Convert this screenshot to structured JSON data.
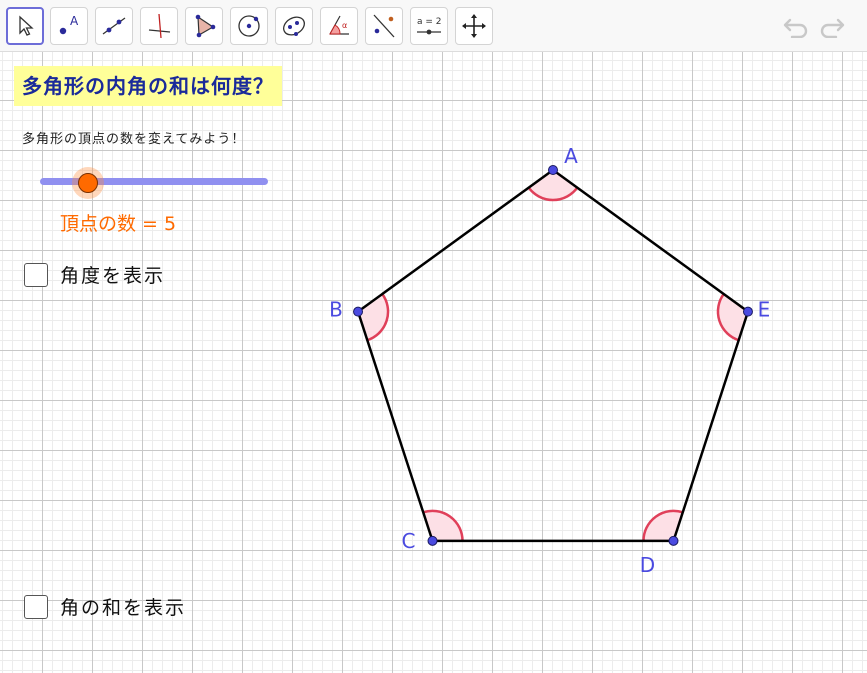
{
  "toolbar": {
    "tools": [
      {
        "name": "move-tool-icon",
        "active": true
      },
      {
        "name": "point-tool-icon",
        "glyph": "A"
      },
      {
        "name": "line-tool-icon"
      },
      {
        "name": "perpendicular-line-tool-icon"
      },
      {
        "name": "polygon-tool-icon"
      },
      {
        "name": "circle-tool-icon"
      },
      {
        "name": "conic-tool-icon"
      },
      {
        "name": "angle-tool-icon"
      },
      {
        "name": "reflect-tool-icon"
      },
      {
        "name": "slider-tool-icon",
        "glyph": "a = 2"
      },
      {
        "name": "move-graphics-view-tool-icon"
      }
    ],
    "undo_icon": "undo-icon",
    "redo_icon": "redo-icon"
  },
  "panel": {
    "title": "多角形の内角の和は何度？",
    "instruction": "多角形の頂点の数を変えてみよう！",
    "slider": {
      "label": "頂点の数",
      "value": 5,
      "min": 3,
      "max": 12
    },
    "slider_readout": "頂点の数 = 5",
    "checkbox_show_angles": {
      "label": "角度を表示",
      "checked": false
    },
    "checkbox_show_sum": {
      "label": "角の和を表示",
      "checked": false
    }
  },
  "polygon": {
    "vertex_labels": [
      "A",
      "B",
      "C",
      "D",
      "E"
    ],
    "edge_color": "#000000",
    "vertex_color": "#4a4ae0",
    "angle_fill": "#fde0e6",
    "angle_stroke": "#e0405a"
  },
  "colors": {
    "title_bg": "#ffff99",
    "title_text": "#1a2a9a",
    "slider_track": "#9090f0",
    "slider_knob": "#ff6a00",
    "active_tool_border": "#6d6dd8"
  }
}
